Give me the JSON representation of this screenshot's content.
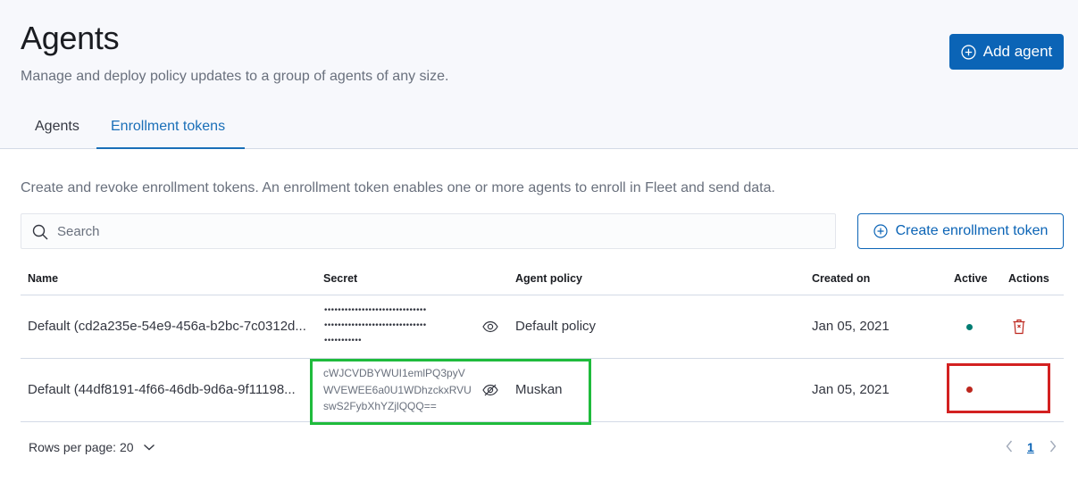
{
  "header": {
    "title": "Agents",
    "subtitle": "Manage and deploy policy updates to a group of agents of any size.",
    "add_agent_label": "Add agent"
  },
  "tabs": [
    {
      "label": "Agents",
      "selected": false
    },
    {
      "label": "Enrollment tokens",
      "selected": true
    }
  ],
  "description": "Create and revoke enrollment tokens. An enrollment token enables one or more agents to enroll in Fleet and send data.",
  "search": {
    "placeholder": "Search",
    "value": ""
  },
  "create_token_label": "Create enrollment token",
  "table": {
    "columns": [
      "Name",
      "Secret",
      "Agent policy",
      "Created on",
      "Active",
      "Actions"
    ],
    "rows": [
      {
        "name": "Default (cd2a235e-54e9-456a-b2bc-7c0312d...",
        "secret_masked": [
          "••••••••••••••••••••••••••••••",
          "••••••••••••••••••••••••••••••",
          "•••••••••••"
        ],
        "secret_visible": false,
        "agent_policy": "Default policy",
        "created_on": "Jan 05, 2021",
        "active": true,
        "active_color": "#017d73",
        "actions": [
          "trash-icon"
        ]
      },
      {
        "name": "Default (44df8191-4f66-46db-9d6a-9f11198...",
        "secret_lines": [
          "cWJCVDBYWUI1emlPQ3pyV",
          "WVEWEE6a0U1WDhzckxRVU",
          "swS2FybXhYZjlQQQ=="
        ],
        "secret_visible": true,
        "agent_policy": "Muskan",
        "created_on": "Jan 05, 2021",
        "active": false,
        "active_color": "#bd271e",
        "actions": []
      }
    ]
  },
  "pagination": {
    "rows_per_page_label": "Rows per page: 20",
    "current_page": "1"
  },
  "colors": {
    "primary": "#0b64b6",
    "highlight_green": "#1fbb3c",
    "highlight_red": "#d32121",
    "danger": "#bd271e"
  }
}
